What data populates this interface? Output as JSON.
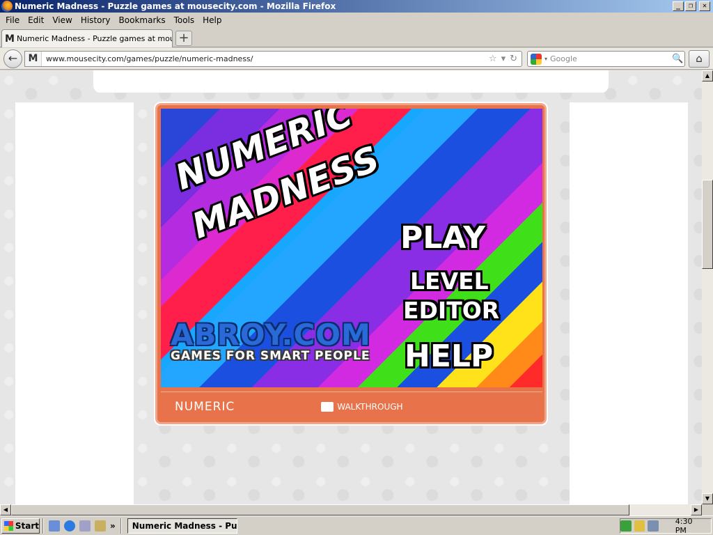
{
  "window": {
    "title": "Numeric Madness - Puzzle games at mousecity.com - Mozilla Firefox",
    "buttons": {
      "minimize": "_",
      "restore": "❐",
      "close": "✕"
    }
  },
  "menubar": [
    "File",
    "Edit",
    "View",
    "History",
    "Bookmarks",
    "Tools",
    "Help"
  ],
  "tab": {
    "favicon": "M",
    "label": "Numeric Madness - Puzzle games at mouseci...",
    "new_tab": "+"
  },
  "navbar": {
    "back": "←",
    "site_id": "M",
    "url": "www.mousecity.com/games/puzzle/numeric-madness/",
    "star": "☆",
    "dropdown": "▾",
    "reload": "↻",
    "search_placeholder": "Google",
    "search_arrow": "▾",
    "magnifier": "🔍",
    "home": "⌂"
  },
  "game": {
    "title_line1": "NUMERIC",
    "title_line2": "MADNESS",
    "options": {
      "play": "PLAY",
      "level": "LEVEL",
      "editor": "EDITOR",
      "help": "HELP"
    },
    "brand": {
      "name": "ABROY.COM",
      "tagline": "GAMES FOR SMART PEOPLE"
    },
    "toolbar": {
      "name": "NUMERIC",
      "walkthrough": "WALKTHROUGH"
    }
  },
  "scrollbars": {
    "up": "▲",
    "down": "▼",
    "left": "◀",
    "right": "▶"
  },
  "taskbar": {
    "start": "Start",
    "quicklaunch_more": "»",
    "task_label": "Numeric Madness - Pu...",
    "clock": "4:30 PM"
  }
}
